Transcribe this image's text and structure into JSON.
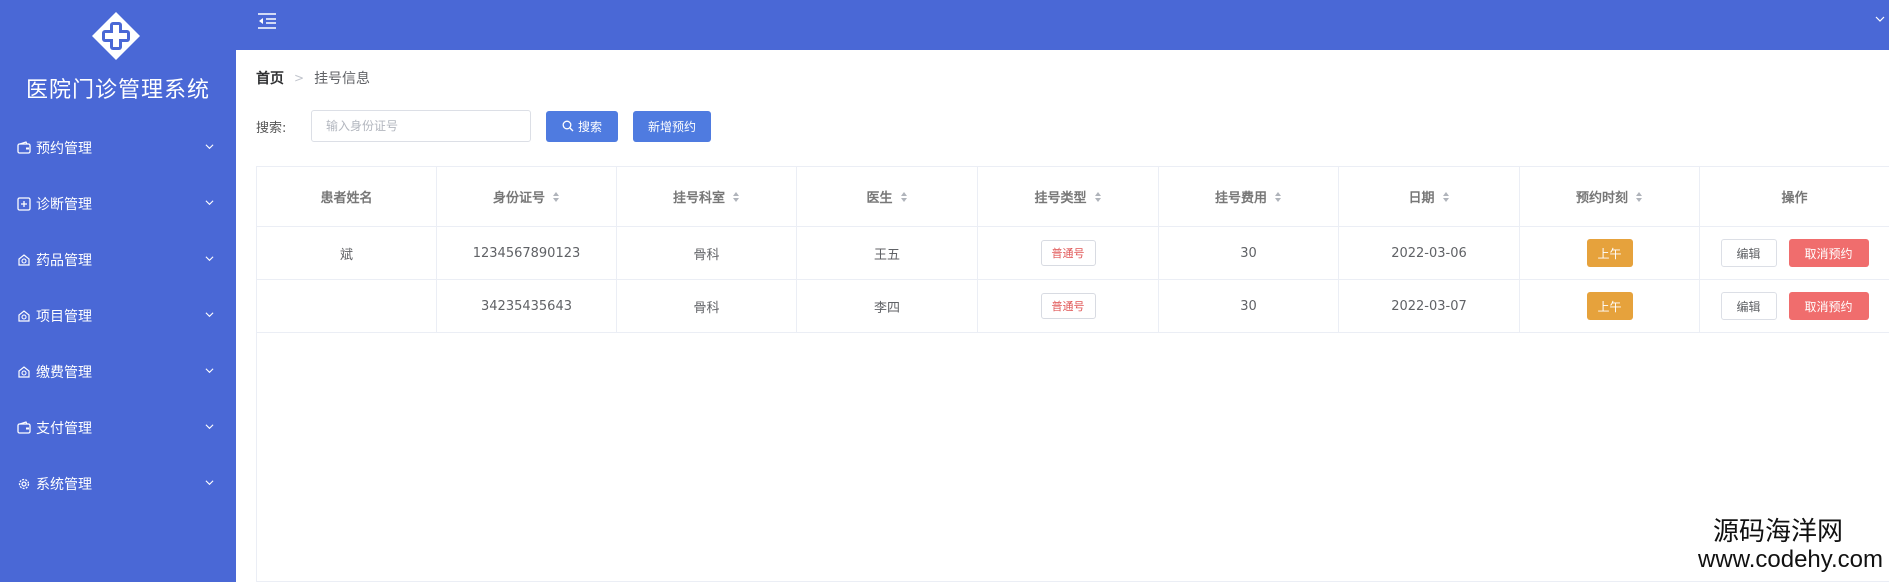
{
  "app": {
    "title": "医院门诊管理系统",
    "accent_color": "#4a68d6"
  },
  "sidebar": {
    "items": [
      {
        "label": "预约管理",
        "icon": "wallet-icon"
      },
      {
        "label": "诊断管理",
        "icon": "plus-square-icon"
      },
      {
        "label": "药品管理",
        "icon": "medicine-icon"
      },
      {
        "label": "项目管理",
        "icon": "medicine-icon"
      },
      {
        "label": "缴费管理",
        "icon": "medicine-icon"
      },
      {
        "label": "支付管理",
        "icon": "wallet-icon"
      },
      {
        "label": "系统管理",
        "icon": "gear-icon"
      }
    ]
  },
  "breadcrumb": {
    "home": "首页",
    "separator": ">",
    "current": "挂号信息"
  },
  "search": {
    "label": "搜索:",
    "placeholder": "输入身份证号",
    "value": "",
    "search_button": "搜索",
    "add_button": "新增预约"
  },
  "table": {
    "columns": [
      "患者姓名",
      "身份证号",
      "挂号科室",
      "医生",
      "挂号类型",
      "挂号费用",
      "日期",
      "预约时刻",
      "操作"
    ],
    "sortable": [
      false,
      true,
      true,
      true,
      true,
      true,
      true,
      true,
      false
    ],
    "rows": [
      {
        "name": "斌",
        "id_number": "1234567890123",
        "department": "骨科",
        "doctor": "王五",
        "type": "普通号",
        "fee": "30",
        "date": "2022-03-06",
        "time": "上午",
        "edit": "编辑",
        "cancel": "取消预约"
      },
      {
        "name": "",
        "id_number": "34235435643",
        "department": "骨科",
        "doctor": "李四",
        "type": "普通号",
        "fee": "30",
        "date": "2022-03-07",
        "time": "上午",
        "edit": "编辑",
        "cancel": "取消预约"
      }
    ],
    "colors": {
      "time_tag": "#e6a23c",
      "cancel_button": "#f06d6d",
      "type_text": "#e05656"
    }
  },
  "watermark": {
    "line1": "源码海洋网",
    "line2": "www.codehy.com"
  }
}
